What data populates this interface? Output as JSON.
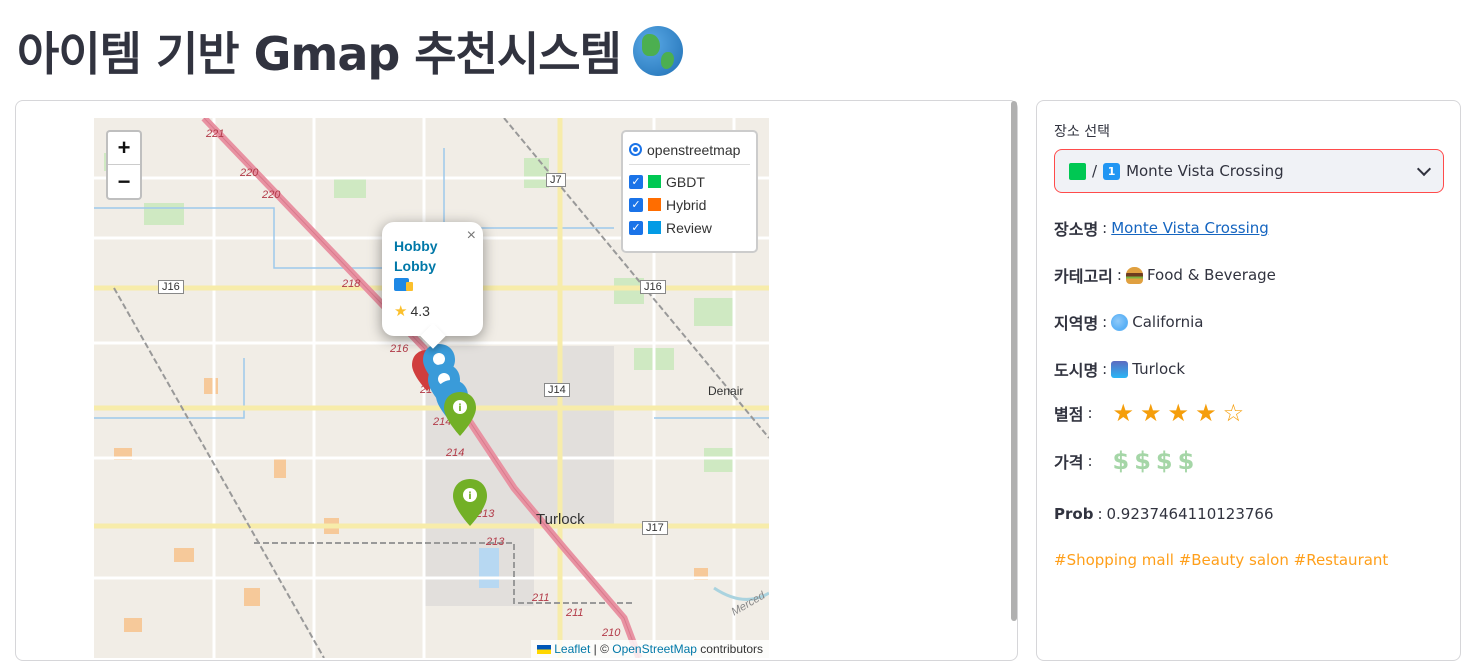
{
  "header": {
    "title": "아이템 기반 Gmap 추천시스템"
  },
  "map": {
    "zoom_in": "+",
    "zoom_out": "−",
    "layer_control": {
      "base_layer": "openstreetmap",
      "overlays": [
        {
          "label": "GBDT",
          "checked": true,
          "color": "#00c853"
        },
        {
          "label": "Hybrid",
          "checked": true,
          "color": "#ff6d00"
        },
        {
          "label": "Review",
          "checked": true,
          "color": "#039be5"
        }
      ]
    },
    "popup": {
      "name": "Hobby Lobby",
      "rating": "4.3",
      "close": "×"
    },
    "place_labels": [
      "Turlock",
      "Denair",
      "Merced"
    ],
    "road_labels": [
      "221",
      "220",
      "220",
      "218",
      "216",
      "215",
      "214",
      "214",
      "213",
      "213",
      "211",
      "211",
      "210",
      "J7",
      "J16",
      "J16",
      "J14",
      "J17"
    ],
    "attribution": {
      "leaflet": "Leaflet",
      "sep": " | © ",
      "osm": "OpenStreetMap",
      "suffix": " contributors"
    }
  },
  "sidebar": {
    "select_label": "장소 선택",
    "select_value": "Monte Vista Crossing",
    "select_sep": "/",
    "select_rank": "1",
    "place_name_key": "장소명",
    "place_name": "Monte Vista Crossing",
    "category_key": "카테고리",
    "category": "Food & Beverage",
    "region_key": "지역명",
    "region": "California",
    "city_key": "도시명",
    "city": "Turlock",
    "rating_key": "별점",
    "rating_stars": 4,
    "rating_max": 5,
    "price_key": "가격",
    "price_level": 4,
    "prob_key": "Prob",
    "prob": "0.9237464110123766",
    "colon": ":",
    "tags": "#Shopping mall #Beauty salon #Restaurant"
  }
}
